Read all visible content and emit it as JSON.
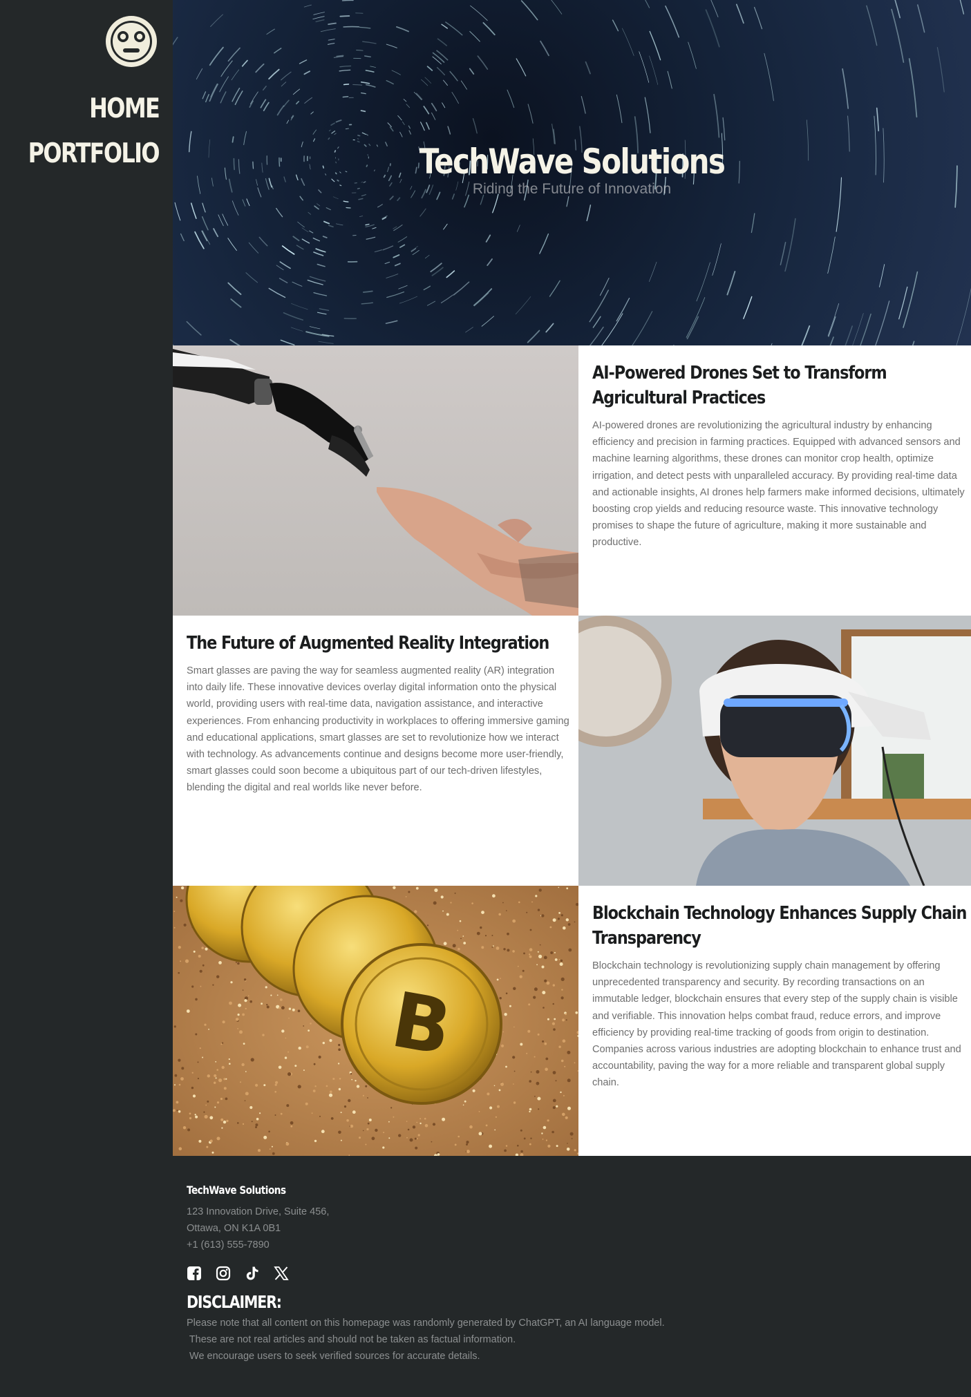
{
  "nav": {
    "logo_icon": "face-logo-icon",
    "items": [
      {
        "label": "HOME"
      },
      {
        "label": "PORTFOLIO"
      }
    ]
  },
  "hero": {
    "title": "TechWave Solutions",
    "subtitle": "Riding the Future of Innovation",
    "background": "star-trails-image"
  },
  "articles": [
    {
      "title": "AI-Powered Drones Set to Transform Agricultural Practices",
      "body": "AI-powered drones are revolutionizing the agricultural industry by enhancing efficiency and precision in farming practices. Equipped with advanced sensors and machine learning algorithms, these drones can monitor crop health, optimize irrigation, and detect pests with unparalleled accuracy. By providing real-time data and actionable insights, AI drones help farmers make informed decisions, ultimately boosting crop yields and reducing resource waste. This innovative technology promises to shape the future of agriculture, making it more sustainable and productive.",
      "image": "robot-hand-touching-human-hand-image"
    },
    {
      "title": "The Future of Augmented Reality Integration",
      "body": "Smart glasses are paving the way for seamless augmented reality (AR) integration into daily life. These innovative devices overlay digital information onto the physical world, providing users with real-time data, navigation assistance, and interactive experiences. From enhancing productivity in workplaces to offering immersive gaming and educational applications, smart glasses are set to revolutionize how we interact with technology. As advancements continue and designs become more user-friendly, smart glasses could soon become a ubiquitous part of our tech-driven lifestyles, blending the digital and real worlds like never before.",
      "image": "child-wearing-vr-headset-image"
    },
    {
      "title": "Blockchain Technology Enhances Supply Chain Transparency",
      "body": "Blockchain technology is revolutionizing supply chain management by offering unprecedented transparency and security. By recording transactions on an immutable ledger, blockchain ensures that every step of the supply chain is visible and verifiable. This innovation helps combat fraud, reduce errors, and improve efficiency by providing real-time tracking of goods from origin to destination. Companies across various industries are adopting blockchain to enhance trust and accountability, paving the way for a more reliable and transparent global supply chain.",
      "image": "gold-bitcoin-coins-image"
    }
  ],
  "footer": {
    "brand": "TechWave Solutions",
    "address_line1": "123 Innovation Drive, Suite 456,",
    "address_line2": "Ottawa, ON K1A 0B1",
    "phone": "+1 (613) 555-7890",
    "socials": [
      "facebook-icon",
      "instagram-icon",
      "tiktok-icon",
      "x-icon"
    ],
    "disclaimer_title": "DISCLAIMER:",
    "disclaimer_line1": "Please note that all content on this homepage was randomly generated by ChatGPT, an AI language model.",
    "disclaimer_line2": " These are not real articles and should not be taken as factual information.",
    "disclaimer_line3": " We encourage users to seek verified sources for accurate details."
  },
  "colors": {
    "sidebar_bg": "#242829",
    "nav_text": "#f5f3e7",
    "article_title": "#1b1d1e",
    "article_body": "#6e6e6e",
    "footer_text": "#8c8f90"
  }
}
